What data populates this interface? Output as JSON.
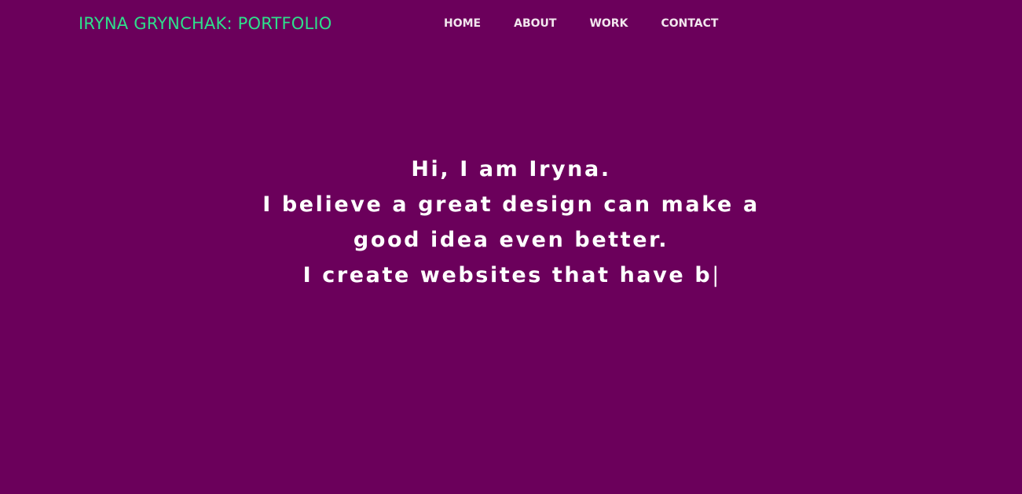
{
  "header": {
    "site_title": "IRYNA GRYNCHAK: PORTFOLIO",
    "nav": [
      {
        "label": "HOME"
      },
      {
        "label": "ABOUT"
      },
      {
        "label": "WORK"
      },
      {
        "label": "CONTACT"
      }
    ]
  },
  "hero": {
    "lines": [
      "Hi, I am Iryna.",
      "I believe a great design can make a",
      "good idea even better.",
      "I create websites that have b"
    ],
    "cursor": "|"
  },
  "colors": {
    "background": "#6b005b",
    "title_accent": "#2ee08c",
    "nav_text": "#f2e6ee",
    "hero_text": "#ffffff"
  }
}
